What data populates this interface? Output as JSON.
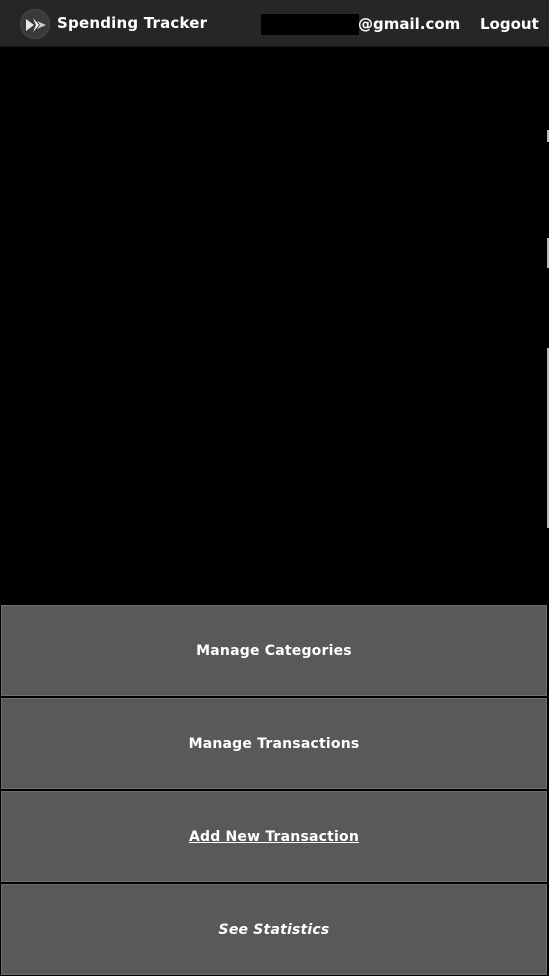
{
  "header": {
    "app_title": "Spending Tracker",
    "email_suffix": "@gmail.com",
    "logout_label": "Logout",
    "logo_icon": "kivy-logo-icon"
  },
  "actions": {
    "manage_categories": "Manage Categories",
    "manage_transactions": "Manage Transactions",
    "add_new_transaction": "Add New Transaction",
    "see_statistics": "See Statistics"
  },
  "colors": {
    "topbar": "#262626",
    "background": "#000000",
    "button": "#595959",
    "text": "#ffffff"
  }
}
